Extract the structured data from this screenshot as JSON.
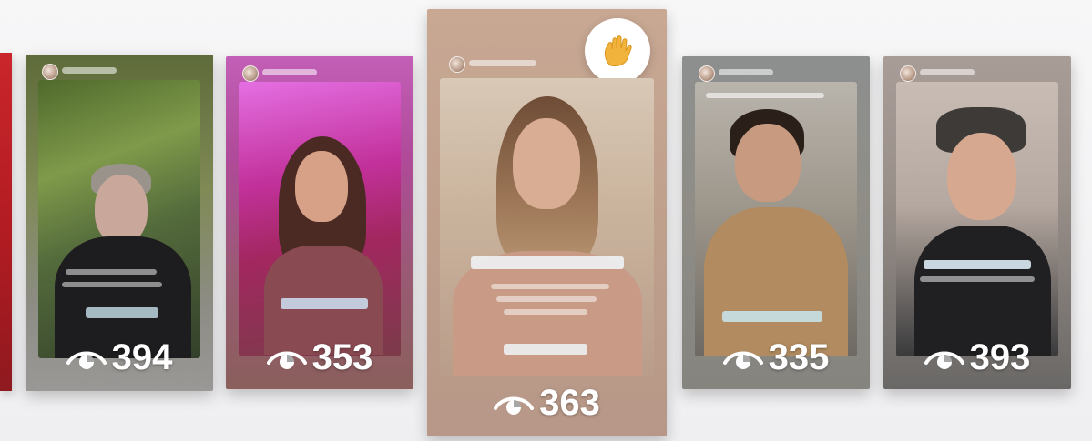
{
  "carousel": {
    "stories": [
      {
        "id": "story-1",
        "views": "394"
      },
      {
        "id": "story-2",
        "views": "353"
      },
      {
        "id": "story-3",
        "views": "363",
        "reaction_icon": "waving-hand-icon"
      },
      {
        "id": "story-4",
        "views": "335"
      },
      {
        "id": "story-5",
        "views": "393"
      }
    ]
  },
  "colors": {
    "view_count_text": "#ffffff",
    "edge_card": "#c9262b"
  }
}
